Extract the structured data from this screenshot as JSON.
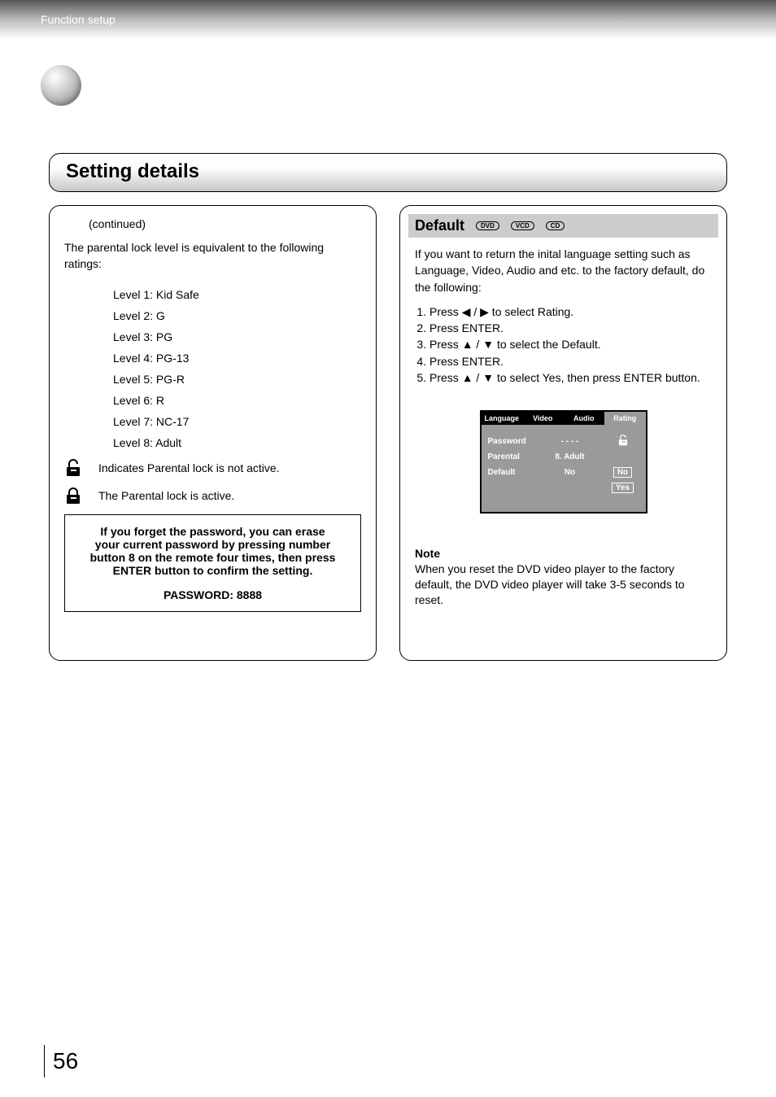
{
  "header": {
    "section": "Function setup"
  },
  "title": "Setting details",
  "left": {
    "continued": "(continued)",
    "intro": "The parental lock level is equivalent to the following ratings:",
    "levels": [
      "Level 1: Kid Safe",
      "Level 2: G",
      "Level 3: PG",
      "Level 4: PG-13",
      "Level 5: PG-R",
      "Level 6: R",
      "Level 7: NC-17",
      "Level 8: Adult"
    ],
    "lock_inactive": "Indicates Parental lock is not active.",
    "lock_active": "The Parental lock is active.",
    "pwbox_l1": "If you forget the password, you can erase",
    "pwbox_l2": "your current password by pressing number",
    "pwbox_l3": "button 8 on the remote four times, then press",
    "pwbox_l4": "ENTER button to confirm the setting.",
    "pwbox_pw": "PASSWORD: 8888"
  },
  "right": {
    "heading": "Default",
    "badges": [
      "DVD",
      "VCD",
      "CD"
    ],
    "intro": "If you want to return the inital language setting such as Language, Video, Audio and etc. to the factory default, do the following:",
    "steps": {
      "s1a": "Press ",
      "s1b": " / ",
      "s1c": " to select Rating.",
      "s2": "Press ENTER.",
      "s3a": "Press ",
      "s3b": " / ",
      "s3c": " to select the Default.",
      "s4": "Press ENTER.",
      "s5a": "Press ",
      "s5b": " / ",
      "s5c": " to select Yes, then press ENTER button."
    },
    "osd": {
      "tabs": [
        "Language",
        "Video",
        "Audio",
        "Rating"
      ],
      "rows": {
        "password": {
          "label": "Password",
          "val": "- - - -"
        },
        "parental": {
          "label": "Parental",
          "val": "8. Adult"
        },
        "default": {
          "label": "Default",
          "val": "No"
        }
      },
      "options": {
        "no": "No",
        "yes": "Yes"
      }
    },
    "note_label": "Note",
    "note_body": "When you reset the DVD video player to the factory default, the DVD video player will take 3-5 seconds to reset."
  },
  "page_number": "56"
}
